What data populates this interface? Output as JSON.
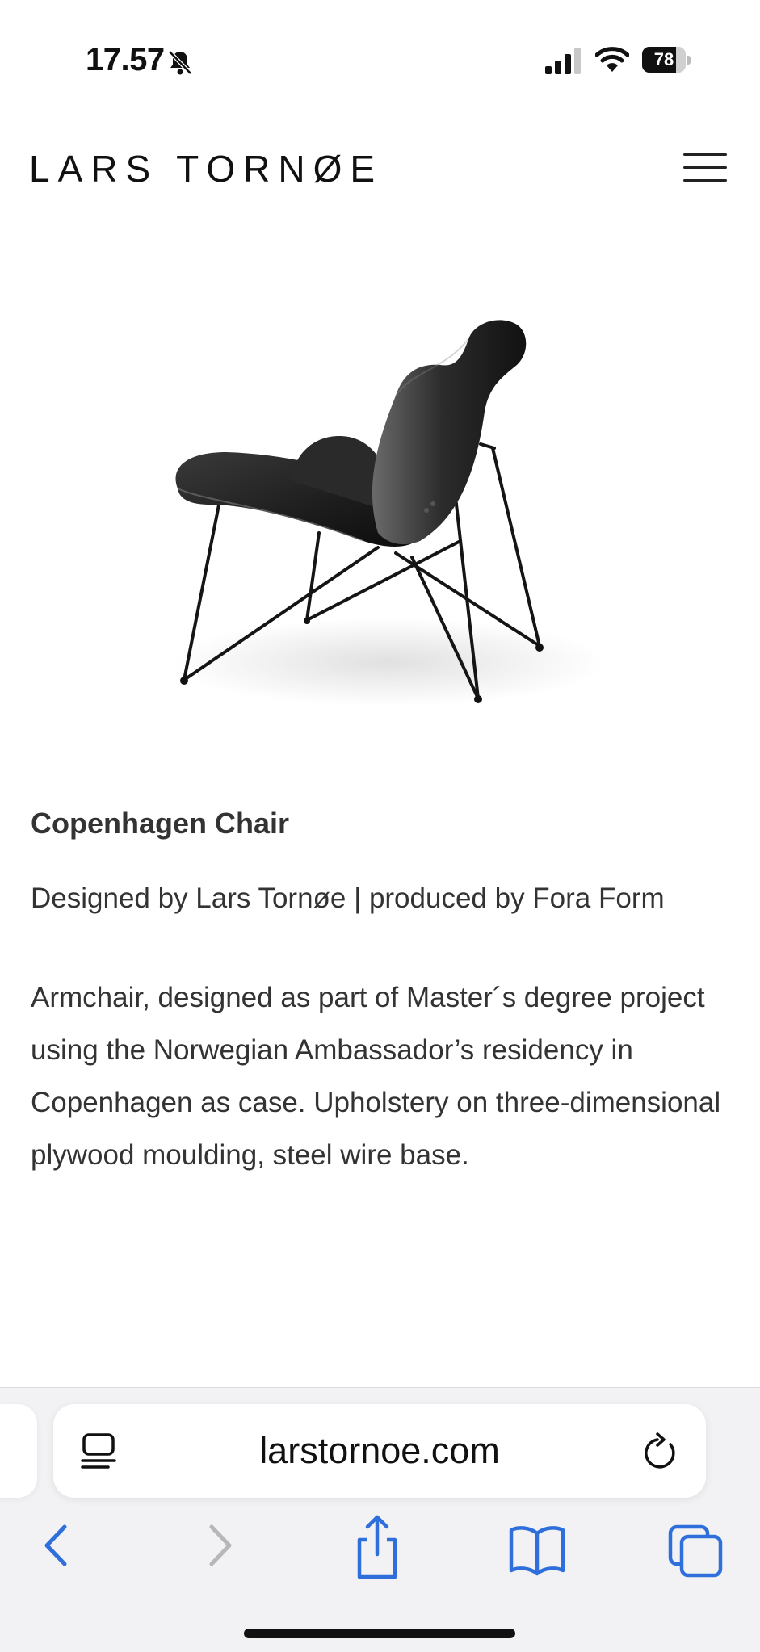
{
  "status_bar": {
    "time": "17.57",
    "battery_percent": 78,
    "battery_label": "78",
    "icons": [
      "bell-slash-icon",
      "cellular-signal-icon",
      "wifi-icon",
      "battery-icon"
    ]
  },
  "header": {
    "logo": "LARS TORNØE",
    "menu_icon": "hamburger-menu-icon"
  },
  "product": {
    "image": "chair-photo",
    "title": "Copenhagen Chair",
    "credits": "Designed by Lars Tornøe  |  produced by Fora Form",
    "description": "Armchair, designed as part of Master´s degree project using the Norwegian Ambassador’s residency in Copenhagen as case. Upholstery on three-dimensional plywood moulding, steel wire base."
  },
  "browser": {
    "url": "larstornoe.com",
    "icons": {
      "reader": "reader-mode-icon",
      "reload": "reload-icon",
      "back": "back-chevron-icon",
      "forward": "forward-chevron-icon",
      "share": "share-icon",
      "bookmarks": "bookmarks-icon",
      "tabs": "tabs-icon"
    },
    "accent_color": "#2f6fdc",
    "disabled_color": "#b7b7bb"
  }
}
